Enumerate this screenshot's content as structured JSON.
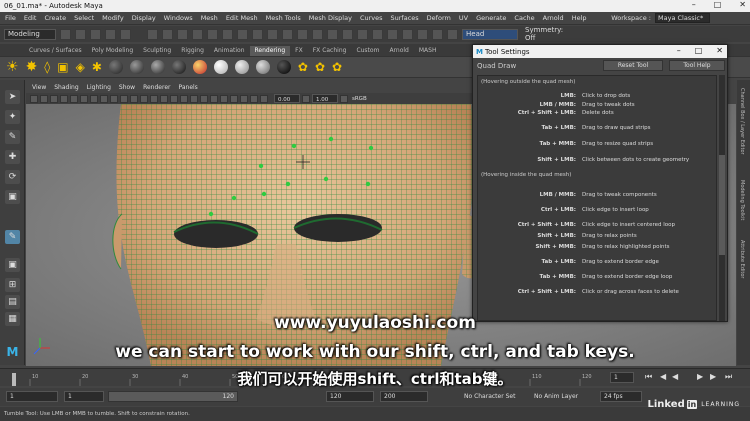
{
  "window": {
    "title": "06_01.ma* - Autodesk Maya"
  },
  "menubar": {
    "items": [
      "File",
      "Edit",
      "Create",
      "Select",
      "Modify",
      "Display",
      "Windows",
      "Mesh",
      "Edit Mesh",
      "Mesh Tools",
      "Mesh Display",
      "Curves",
      "Surfaces",
      "Deform",
      "UV",
      "Generate",
      "Cache",
      "Arnold",
      "Help"
    ],
    "workspace_label": "Workspace :",
    "workspace_value": "Maya Classic*"
  },
  "statusline": {
    "mode": "Modeling",
    "object_field": "Head",
    "symmetry": "Symmetry: Off"
  },
  "shelf_tabs": {
    "items": [
      "Curves / Surfaces",
      "Poly Modeling",
      "Sculpting",
      "Rigging",
      "Animation",
      "Rendering",
      "FX",
      "FX Caching",
      "Custom",
      "Arnold",
      "MASH"
    ],
    "active": "Rendering"
  },
  "viewport": {
    "menu": [
      "View",
      "Shading",
      "Lighting",
      "Show",
      "Renderer",
      "Panels"
    ],
    "near_value": "0.00",
    "far_value": "1.00",
    "colorspace": "sRGB"
  },
  "tool_settings": {
    "title": "Tool Settings",
    "tool_name": "Quad Draw",
    "reset_button": "Reset Tool",
    "help_button": "Tool Help",
    "outside_header": "(Hovering outside the quad mesh)",
    "outside": [
      {
        "key": "LMB:",
        "desc": "Click to drop dots"
      },
      {
        "key": "LMB / MMB:",
        "desc": "Drag to tweak dots"
      },
      {
        "key": "Ctrl + Shift + LMB:",
        "desc": "Delete dots"
      },
      {
        "key": "Tab + LMB:",
        "desc": "Drag to draw quad strips"
      },
      {
        "key": "Tab + MMB:",
        "desc": "Drag to resize quad strips"
      },
      {
        "key": "Shift + LMB:",
        "desc": "Click between dots to create geometry"
      }
    ],
    "inside_header": "(Hovering inside the quad mesh)",
    "inside": [
      {
        "key": "LMB / MMB:",
        "desc": "Drag to tweak components"
      },
      {
        "key": "Ctrl + LMB:",
        "desc": "Click edge to insert loop"
      },
      {
        "key": "Ctrl + Shift + LMB:",
        "desc": "Click edge to insert centered loop"
      },
      {
        "key": "Shift + LMB:",
        "desc": "Drag to relax points"
      },
      {
        "key": "Shift + MMB:",
        "desc": "Drag to relax highlighted points"
      },
      {
        "key": "Tab + LMB:",
        "desc": "Drag to extend border edge"
      },
      {
        "key": "Tab + MMB:",
        "desc": "Drag to extend border edge loop"
      },
      {
        "key": "Ctrl + Shift + LMB:",
        "desc": "Click or drag across faces to delete"
      }
    ]
  },
  "right_panel": {
    "tab1": "Channel Box / Layer Editor",
    "tab2": "Modeling Toolkit",
    "tab3": "Attribute Editor"
  },
  "timeline": {
    "ticks": [
      "1",
      "10",
      "20",
      "30",
      "40",
      "50",
      "60",
      "70",
      "80",
      "90",
      "100",
      "110",
      "120"
    ],
    "current_frame": "1"
  },
  "range": {
    "start": "1",
    "inner_start": "1",
    "inner_end": "120",
    "end": "120",
    "max": "200",
    "character_set": "No Character Set",
    "anim_layer": "No Anim Layer",
    "fps": "24 fps"
  },
  "helpline": {
    "text": "Tumble Tool: Use LMB or MMB to tumble. Shift to constrain rotation."
  },
  "subtitles": {
    "url": "www.yuyulaoshi.com",
    "english": "we can start to work with our shift, ctrl, and tab keys.",
    "chinese": "我们可以开始使用shift、ctrl和tab键。"
  },
  "brand": {
    "linkedin": "Linked",
    "in": "in",
    "learning": "LEARNING"
  }
}
